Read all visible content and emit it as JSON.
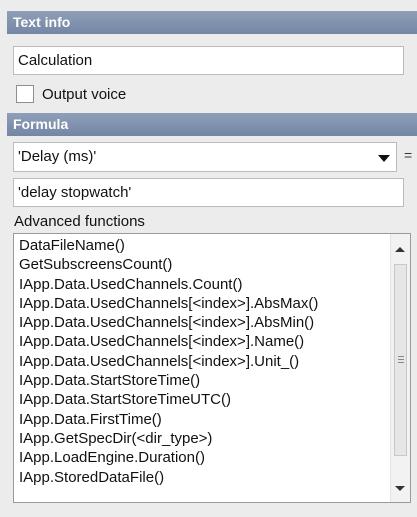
{
  "text_info": {
    "header": "Text info",
    "text_value": "Calculation",
    "output_voice_label": "Output voice",
    "output_voice_checked": false
  },
  "formula": {
    "header": "Formula",
    "selected_value": "'Delay (ms)'",
    "equals_sign": "=",
    "expression": "'delay stopwatch'"
  },
  "advanced": {
    "label": "Advanced functions",
    "items": [
      "DataFileName()",
      "GetSubscreensCount()",
      "IApp.Data.UsedChannels.Count()",
      "IApp.Data.UsedChannels[<index>].AbsMax()",
      "IApp.Data.UsedChannels[<index>].AbsMin()",
      "IApp.Data.UsedChannels[<index>].Name()",
      "IApp.Data.UsedChannels[<index>].Unit_()",
      "IApp.Data.StartStoreTime()",
      "IApp.Data.StartStoreTimeUTC()",
      "IApp.Data.FirstTime()",
      "IApp.GetSpecDir(<dir_type>)",
      "IApp.LoadEngine.Duration()",
      "IApp.StoredDataFile()"
    ]
  }
}
